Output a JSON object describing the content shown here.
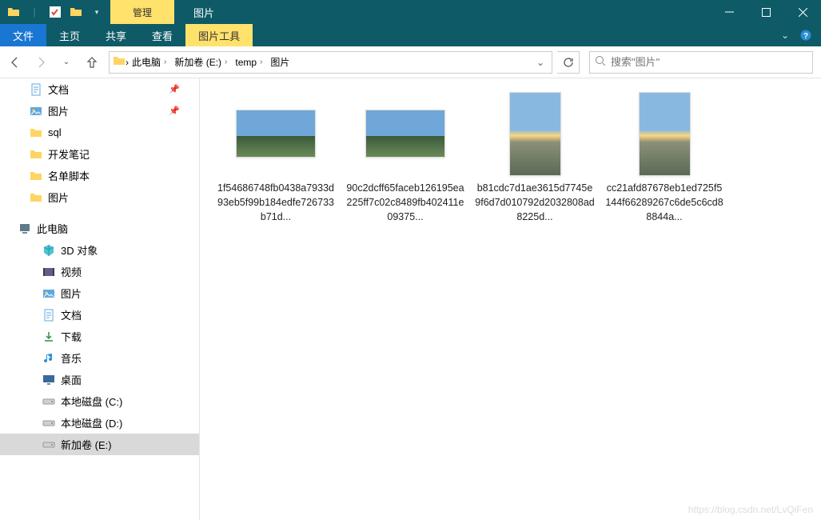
{
  "titlebar": {
    "manage_label": "管理",
    "title": "图片"
  },
  "ribbon": {
    "file": "文件",
    "home": "主页",
    "share": "共享",
    "view": "查看",
    "picture_tools": "图片工具"
  },
  "breadcrumb": {
    "items": [
      "此电脑",
      "新加卷 (E:)",
      "temp",
      "图片"
    ]
  },
  "search": {
    "placeholder": "搜索\"图片\""
  },
  "sidebar": {
    "quick": [
      {
        "label": "文档",
        "icon": "doc",
        "pinned": true
      },
      {
        "label": "图片",
        "icon": "pic",
        "pinned": true
      },
      {
        "label": "sql",
        "icon": "folder"
      },
      {
        "label": "开发笔记",
        "icon": "folder"
      },
      {
        "label": "名单脚本",
        "icon": "folder"
      },
      {
        "label": "图片",
        "icon": "folder"
      }
    ],
    "pc_label": "此电脑",
    "pc_items": [
      {
        "label": "3D 对象",
        "icon": "3d"
      },
      {
        "label": "视频",
        "icon": "video"
      },
      {
        "label": "图片",
        "icon": "pic"
      },
      {
        "label": "文档",
        "icon": "doc"
      },
      {
        "label": "下载",
        "icon": "download"
      },
      {
        "label": "音乐",
        "icon": "music"
      },
      {
        "label": "桌面",
        "icon": "desktop"
      },
      {
        "label": "本地磁盘 (C:)",
        "icon": "disk"
      },
      {
        "label": "本地磁盘 (D:)",
        "icon": "disk"
      },
      {
        "label": "新加卷 (E:)",
        "icon": "disk",
        "selected": true
      }
    ]
  },
  "files": [
    {
      "name": "1f54686748fb0438a7933d93eb5f99b184edfe726733b71d...",
      "orient": "landscape"
    },
    {
      "name": "90c2dcff65faceb126195ea225ff7c02c8489fb402411e09375...",
      "orient": "landscape"
    },
    {
      "name": "b81cdc7d1ae3615d7745e9f6d7d010792d2032808ad8225d...",
      "orient": "portrait"
    },
    {
      "name": "cc21afd87678eb1ed725f5144f66289267c6de5c6cd88844a...",
      "orient": "portrait"
    }
  ],
  "watermark": "https://blog.csdn.net/LvQiFen"
}
